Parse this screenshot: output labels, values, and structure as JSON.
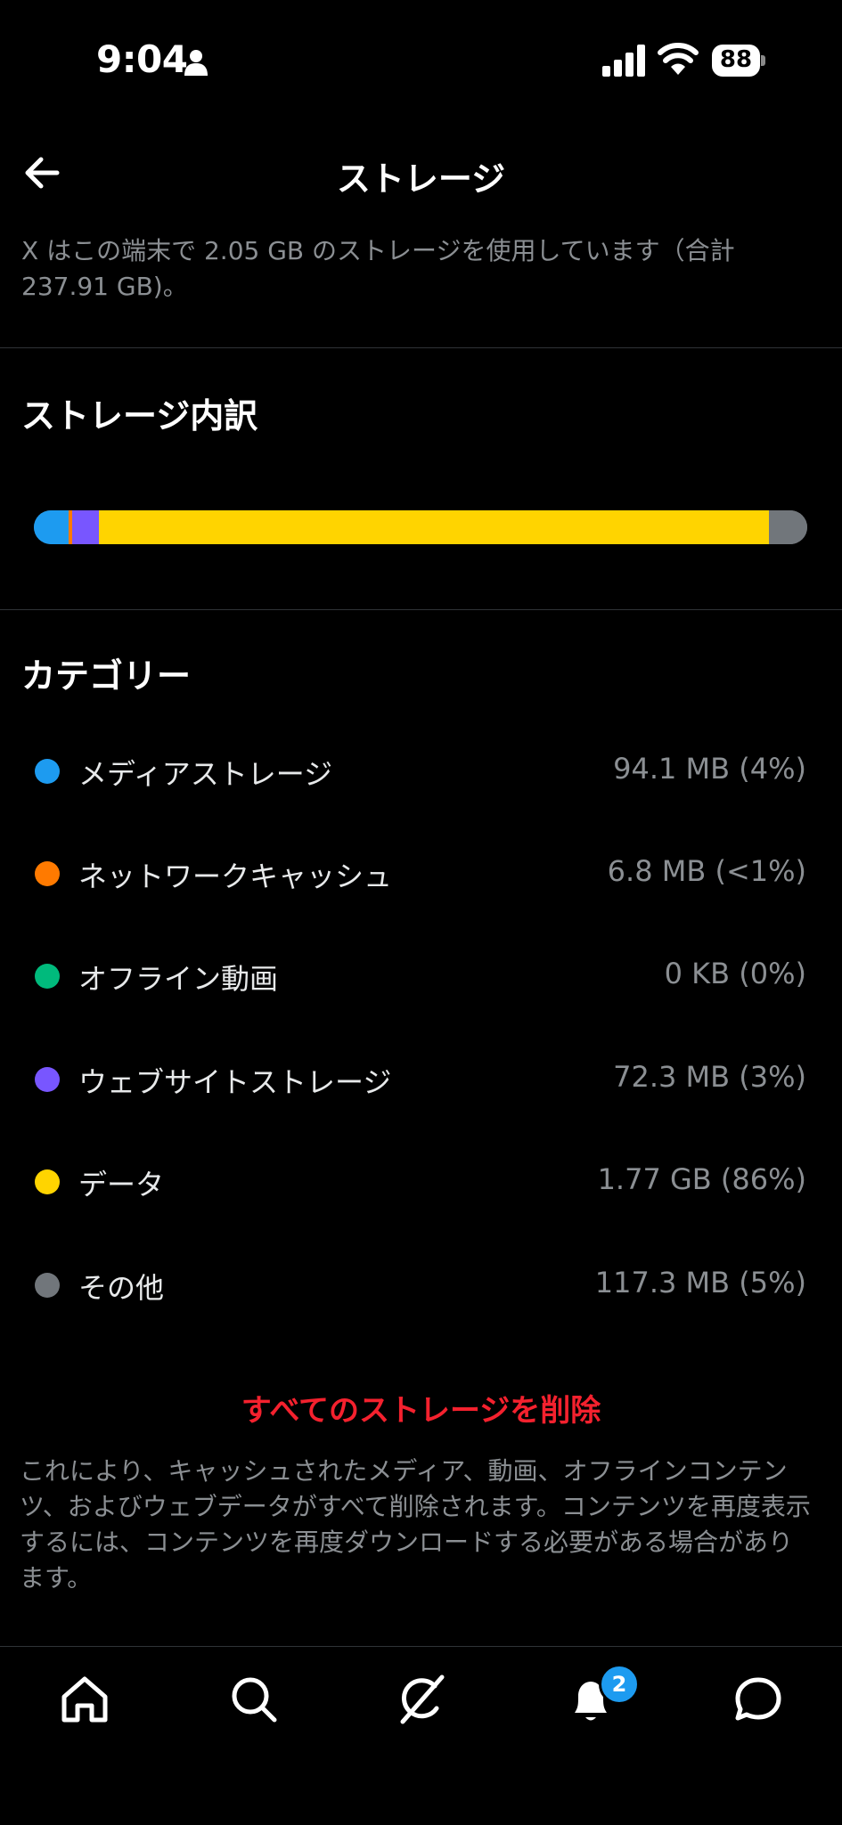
{
  "status_bar": {
    "time": "9:04",
    "battery": "88",
    "icons": [
      "person-icon",
      "signal-icon",
      "wifi-icon",
      "battery-icon"
    ]
  },
  "header": {
    "title": "ストレージ",
    "back_icon": "arrow-left-icon"
  },
  "description": "X はこの端末で 2.05 GB のストレージを使用しています（合計 237.91 GB)。",
  "breakdown": {
    "title": "ストレージ内訳"
  },
  "categories": {
    "title": "カテゴリー",
    "items": [
      {
        "label": "メディアストレージ",
        "value": "94.1 MB (4%)",
        "color": "#1d9bf0",
        "share": 0.045
      },
      {
        "label": "ネットワークキャッシュ",
        "value": "6.8 MB (<1%)",
        "color": "#ff7a00",
        "share": 0.004
      },
      {
        "label": "オフライン動画",
        "value": "0 KB (0%)",
        "color": "#00ba7c",
        "share": 0.0
      },
      {
        "label": "ウェブサイトストレージ",
        "value": "72.3 MB (3%)",
        "color": "#7856ff",
        "share": 0.035
      },
      {
        "label": "データ",
        "value": "1.77 GB (86%)",
        "color": "#ffd400",
        "share": 0.866
      },
      {
        "label": "その他",
        "value": "117.3 MB (5%)",
        "color": "#71767b",
        "share": 0.05
      }
    ]
  },
  "actions": {
    "delete_all": "すべてのストレージを削除"
  },
  "footnote": "これにより、キャッシュされたメディア、動画、オフラインコンテンツ、およびウェブデータがすべて削除されます。コンテンツを再度表示するには、コンテンツを再度ダウンロードする必要がある場合があります。",
  "tabbar": {
    "tabs": [
      "home-icon",
      "search-icon",
      "grok-icon",
      "notifications-icon",
      "messages-icon"
    ],
    "notification_badge": "2"
  },
  "colors": {
    "accent": "#1d9bf0",
    "danger": "#f4212e",
    "background": "#000000",
    "secondary_text": "#8b8f93"
  }
}
